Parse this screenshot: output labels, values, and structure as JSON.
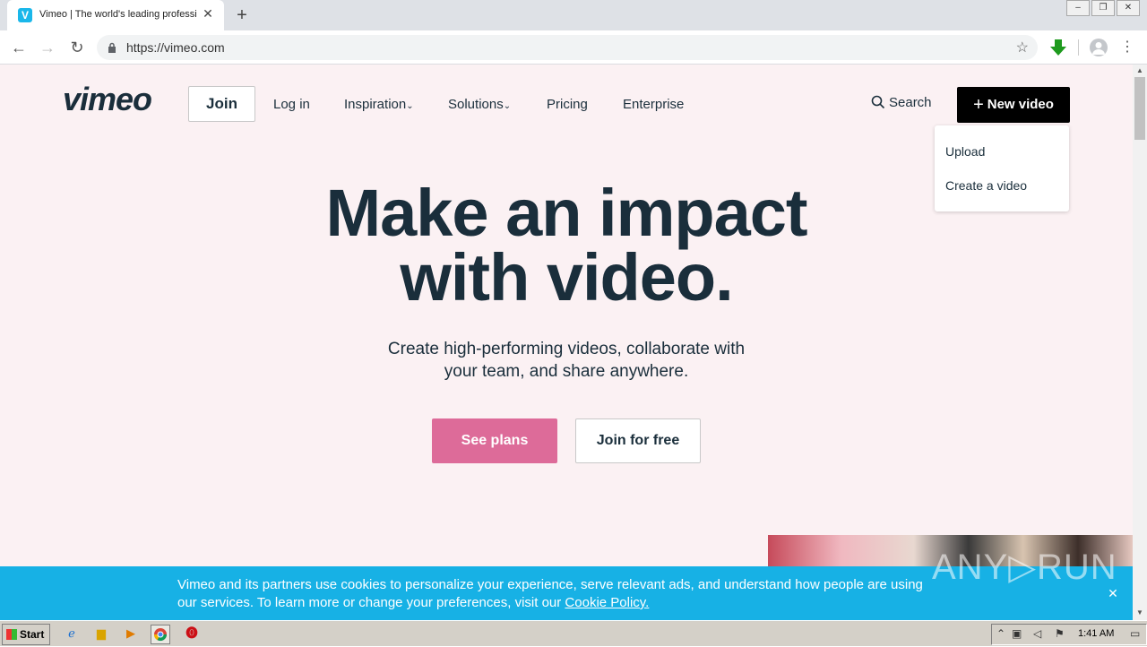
{
  "browser": {
    "tab_title": "Vimeo | The world's leading professional video platform",
    "tab_favicon_letter": "V",
    "url": "https://vimeo.com",
    "new_tab_symbol": "+",
    "close_symbol": "✕"
  },
  "nav": {
    "logo": "vimeo",
    "join": "Join",
    "login": "Log in",
    "inspiration": "Inspiration",
    "solutions": "Solutions",
    "pricing": "Pricing",
    "enterprise": "Enterprise",
    "search": "Search",
    "new_video": "New video"
  },
  "dropdown": {
    "items": [
      "Upload",
      "Create a video"
    ]
  },
  "hero": {
    "title_line1": "Make an impact",
    "title_line2": "with video.",
    "subtitle_line1": "Create high-performing videos, collaborate with",
    "subtitle_line2": "your team, and share anywhere.",
    "primary_cta": "See plans",
    "secondary_cta": "Join for free"
  },
  "cookie": {
    "text_line1": "Vimeo and its partners use cookies to personalize your experience, serve relevant ads, and understand how people are using",
    "text_line2": "our services. To learn more or change your preferences, visit our ",
    "link": "Cookie Policy."
  },
  "watermark": "ANY▷RUN",
  "taskbar": {
    "start": "Start",
    "clock": "1:41 AM"
  },
  "colors": {
    "page_bg": "#fbf1f3",
    "brand_dark": "#1a2e3b",
    "cta_pink": "#dd6b99",
    "cookie_blue": "#17b1e5"
  }
}
